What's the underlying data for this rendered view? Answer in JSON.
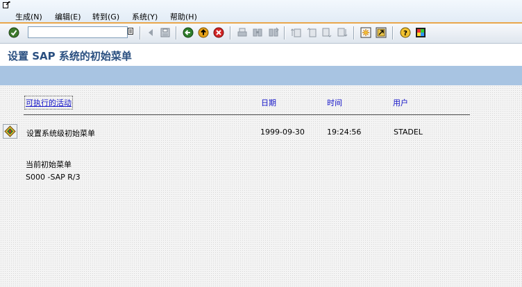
{
  "menu": {
    "items": [
      "生成(N)",
      "编辑(E)",
      "转到(G)",
      "系统(Y)",
      "帮助(H)"
    ]
  },
  "toolbar": {
    "command_field_value": "",
    "icons": [
      "enter-icon",
      "command-dropdown-icon",
      "back-arrow-icon",
      "save-icon",
      "back-icon",
      "exit-icon",
      "cancel-icon",
      "print-icon",
      "find-icon",
      "find-next-icon",
      "first-page-icon",
      "previous-page-icon",
      "next-page-icon",
      "last-page-icon",
      "create-session-icon",
      "shortcut-icon",
      "help-icon",
      "customize-layout-icon"
    ]
  },
  "page": {
    "title": "设置 SAP 系统的初始菜单"
  },
  "table": {
    "columns": [
      "可执行的活动",
      "日期",
      "时间",
      "用户"
    ],
    "row": {
      "activity": "设置系统级初始菜单",
      "date": "1999-09-30",
      "time": "19:24:56",
      "user": "STADEL"
    }
  },
  "current_menu": {
    "label": "当前初始菜单",
    "value": "S000 -SAP R/3"
  },
  "colors": {
    "title_text": "#2a4f80",
    "header_link": "#1414c8",
    "app_toolbar": "#a8c4e2",
    "menubar_accent": "#e9a64a"
  }
}
